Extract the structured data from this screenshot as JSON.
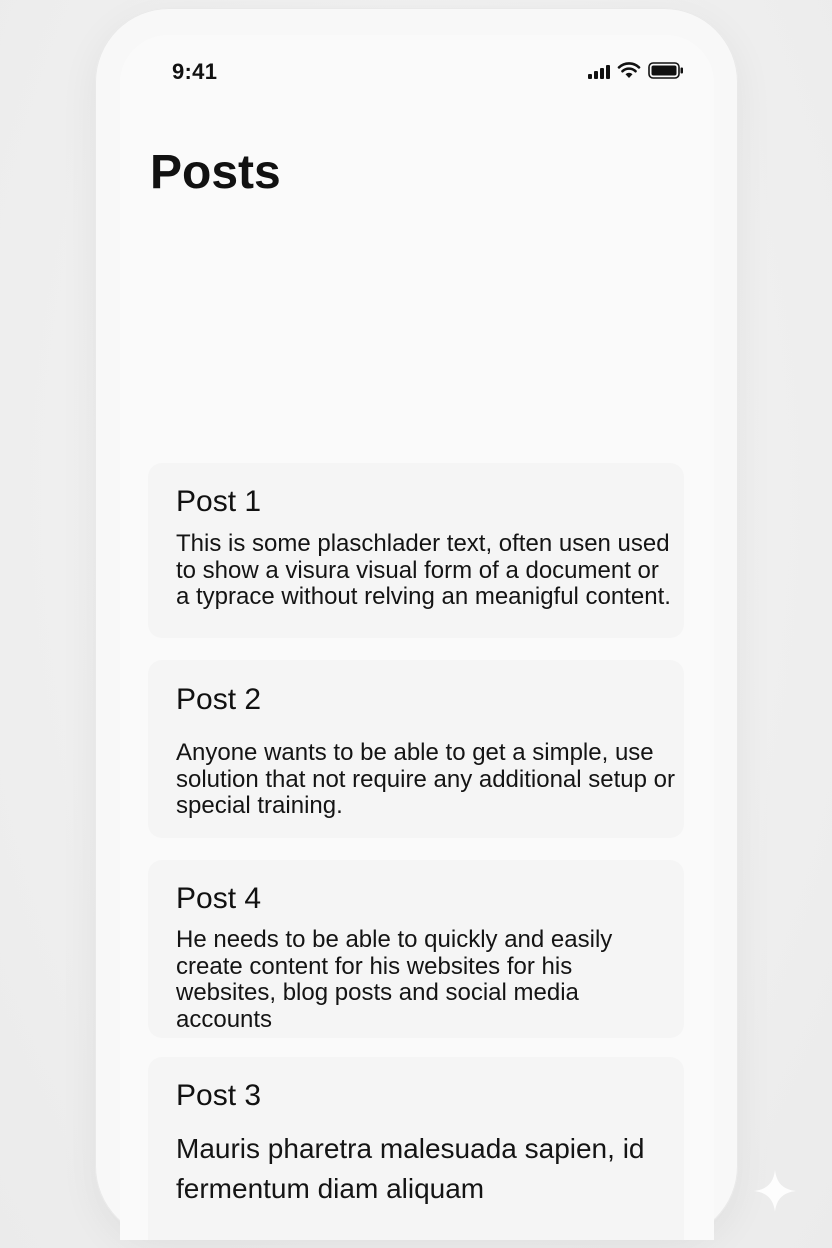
{
  "status_bar": {
    "time": "9:41",
    "icons": [
      "cellular-signal-icon",
      "wifi-icon",
      "battery-icon"
    ]
  },
  "page": {
    "title": "Posts"
  },
  "posts": [
    {
      "title": "Post 1",
      "body": "This is some plaschlader text, often usen used to show a visura visual form of a document or a typrace without relving an meanigful content."
    },
    {
      "title": "Post 2",
      "body": "Anyone wants to be able to get a simple, use solution that not require any additional setup or special training."
    },
    {
      "title": "Post 4",
      "body": "He needs to be able to quickly and easily create content for his websites for his websites, blog posts and social media accounts"
    },
    {
      "title": "Post 3",
      "body": "Mauris pharetra malesuada sapien, id fermentum diam aliquam"
    }
  ],
  "colors": {
    "background": "#efefef",
    "screen": "#fafafa",
    "card": "#f5f5f5",
    "text": "#111111"
  }
}
